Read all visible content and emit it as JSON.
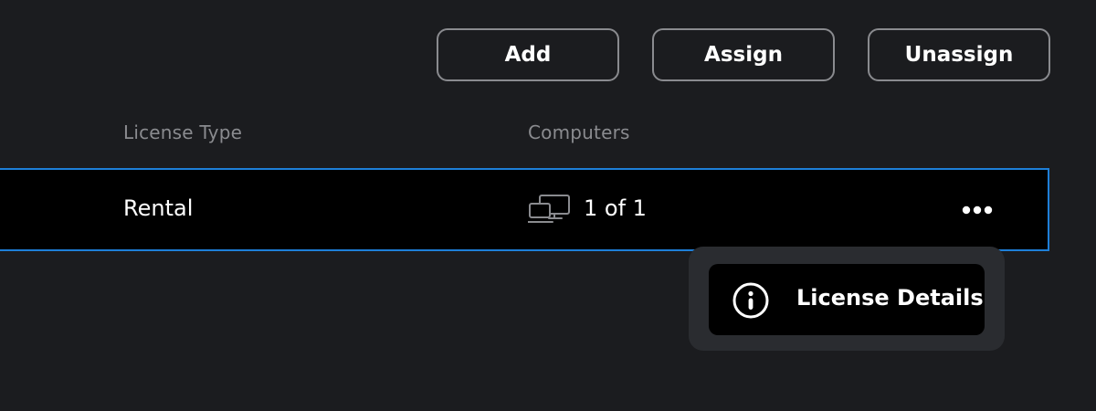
{
  "toolbar": {
    "add_label": "Add",
    "assign_label": "Assign",
    "unassign_label": "Unassign"
  },
  "table": {
    "columns": [
      "License Type",
      "Computers"
    ],
    "rows": [
      {
        "license_type": "Rental",
        "computers": "1 of 1",
        "computers_icon": "computers-icon",
        "actions_icon": "more-horizontal-icon",
        "selected": true
      }
    ]
  },
  "context_menu": {
    "items": [
      {
        "label": "License Details",
        "icon": "info-icon"
      }
    ]
  },
  "colors": {
    "background": "#1b1c1f",
    "row_background": "#000000",
    "row_border_selected": "#1e7fd8",
    "button_border": "#8a8b8f",
    "header_text": "#8a8b8f",
    "menu_background": "#2a2c30"
  }
}
